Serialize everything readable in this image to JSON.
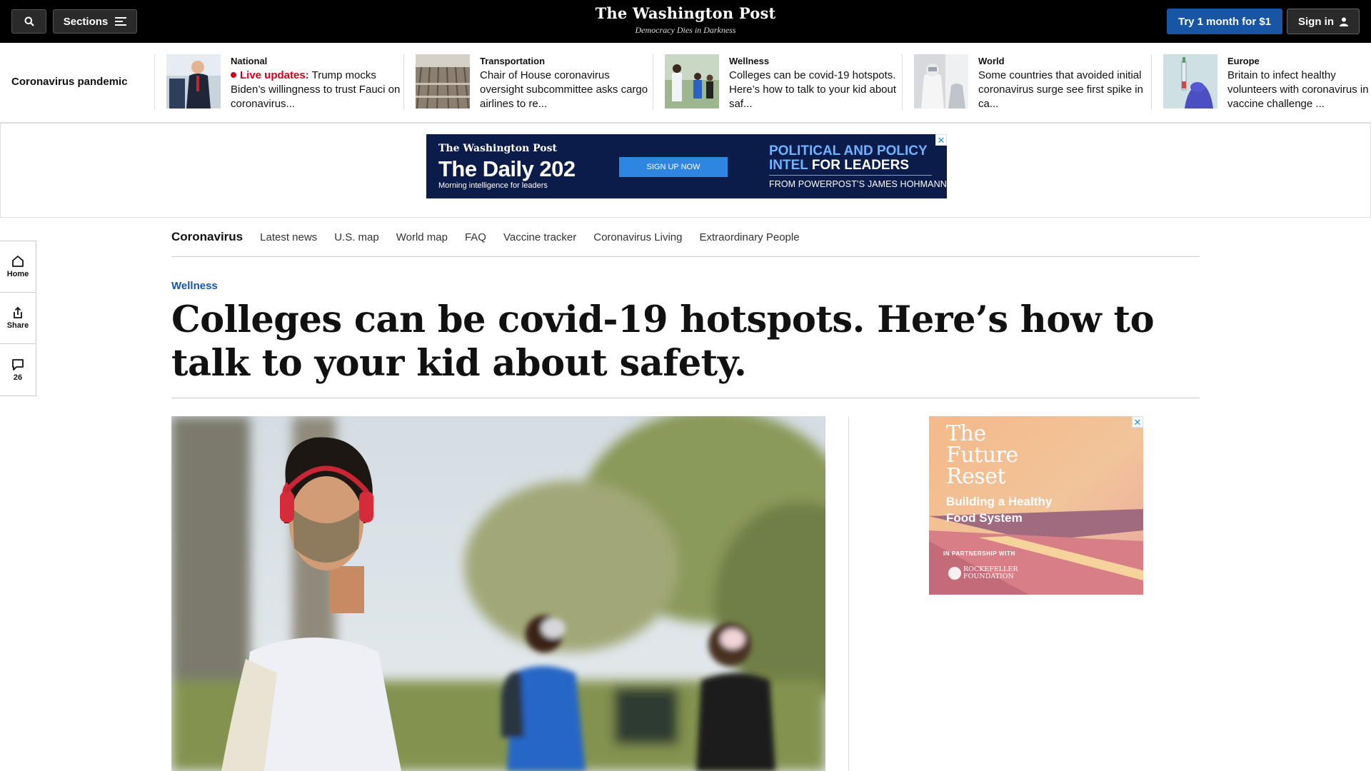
{
  "topbar": {
    "sections_label": "Sections",
    "logo": "The Washington Post",
    "tagline": "Democracy Dies in Darkness",
    "try_label": "Try 1 month for $1",
    "signin_label": "Sign in"
  },
  "strip": {
    "label": "Coronavirus pandemic",
    "items": [
      {
        "kicker": "National",
        "live_label": "Live updates:",
        "headline": "Trump mocks Biden’s willingness to trust Fauci on coronavirus..."
      },
      {
        "kicker": "Transportation",
        "headline": "Chair of House coronavirus oversight subcommittee asks cargo airlines to re..."
      },
      {
        "kicker": "Wellness",
        "headline": "Colleges can be covid-19 hotspots. Here’s how to talk to your kid about saf..."
      },
      {
        "kicker": "World",
        "headline": "Some countries that avoided initial coronavirus surge see first spike in ca..."
      },
      {
        "kicker": "Europe",
        "headline": "Britain to infect healthy volunteers with coronavirus in vaccine challenge ..."
      }
    ]
  },
  "ad_banner": {
    "brand": "The Washington Post",
    "title": "The Daily 202",
    "subtitle": "Morning intelligence for leaders",
    "button": "SIGN UP NOW",
    "right_line1": "POLITICAL AND POLICY",
    "right_line2a": "INTEL",
    "right_line2b": " FOR LEADERS",
    "from": "FROM POWERPOST’S JAMES HOHMANN",
    "close": "✕"
  },
  "secnav": {
    "title": "Coronavirus",
    "links": [
      "Latest news",
      "U.S. map",
      "World map",
      "FAQ",
      "Vaccine tracker",
      "Coronavirus Living",
      "Extraordinary People"
    ]
  },
  "rail": {
    "home": "Home",
    "share": "Share",
    "comments": "26"
  },
  "article": {
    "category": "Wellness",
    "title": "Colleges can be covid-19 hotspots. Here’s how to talk to your kid about safety."
  },
  "ad_side": {
    "title_l1": "The",
    "title_l2": "Future",
    "title_l3": "Reset",
    "sub_l1": "Building a Healthy",
    "sub_l2": "Food System",
    "partner": "IN PARTNERSHIP WITH",
    "foundation_l1": "ROCKEFELLER",
    "foundation_l2": "FOUNDATION",
    "close": "✕"
  },
  "colors": {
    "brand_blue": "#1955a5",
    "live_red": "#d0021b",
    "ad_navy": "#0c1c4a"
  }
}
